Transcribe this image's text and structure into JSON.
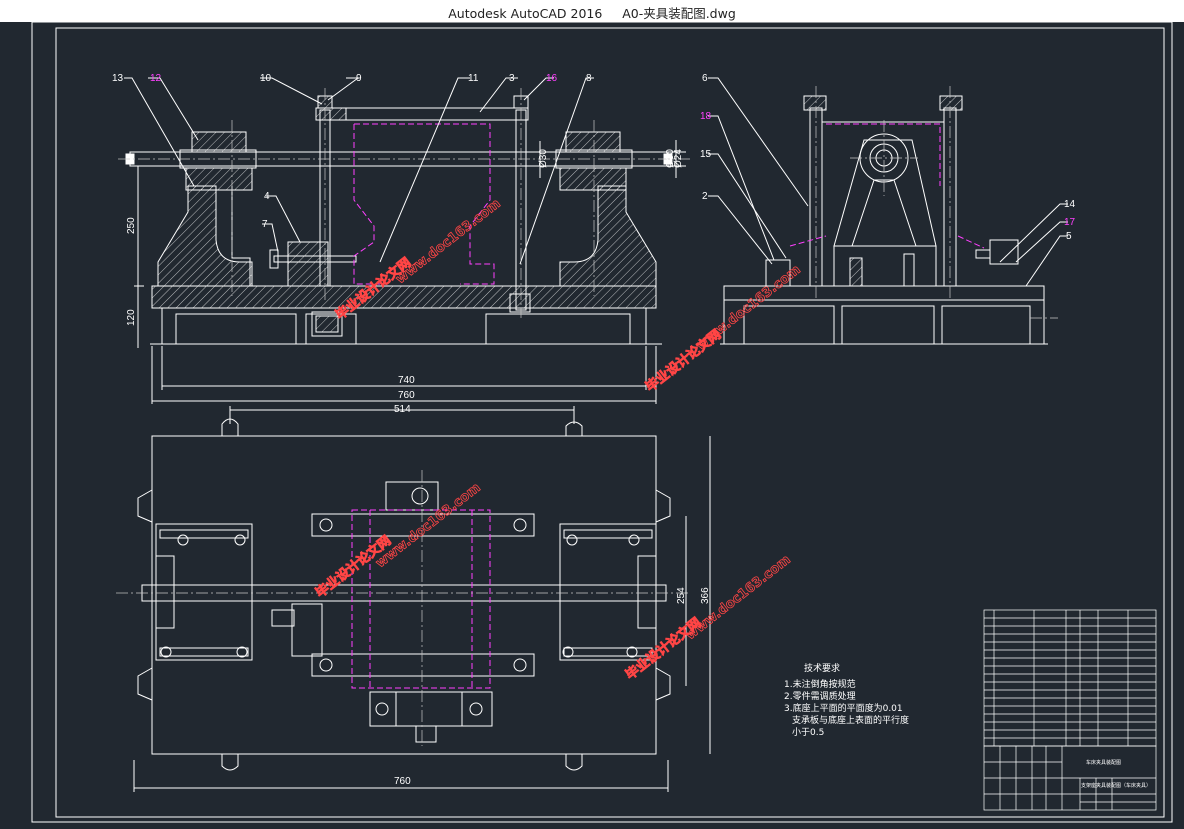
{
  "window": {
    "app_name": "Autodesk AutoCAD 2016",
    "file_name": "A0-夹具装配图.dwg"
  },
  "colors": {
    "background": "#212830",
    "line": "#ffffff",
    "hidden_line": "#ff40ff",
    "watermark": "#ff4545",
    "center_line": "#c8c8c8"
  },
  "front_view": {
    "part_labels": [
      "13",
      "12",
      "10",
      "9",
      "11",
      "3",
      "16",
      "8",
      "4",
      "7"
    ],
    "highlight_labels": [
      "12",
      "16"
    ],
    "dimensions": {
      "shaft_dia_1": "Ø30",
      "shaft_dia_2": "Ø30",
      "shaft_dia_3": "Ø24",
      "height_1": "250",
      "height_2": "120",
      "width_inner": "740",
      "width_outer": "760"
    }
  },
  "side_view": {
    "part_labels": [
      "6",
      "18",
      "15",
      "2",
      "14",
      "17",
      "5"
    ],
    "highlight_labels": [
      "18",
      "17"
    ]
  },
  "top_view": {
    "dimensions": {
      "top_width": "514",
      "bottom_width": "760",
      "height_inner": "254",
      "height_outer": "366"
    }
  },
  "technical_requirements": {
    "heading": "技术要求",
    "items": [
      "1.未注倒角按规范",
      "2.零件需调质处理",
      "3.底座上平面的平面度为0.01",
      "支承板与底座上表面的平行度",
      "小于0.5"
    ]
  },
  "title_block": {
    "drawing_title": "车床夹具装配图",
    "part_name": "支架座夹具装配图（车床夹具）"
  },
  "watermarks": [
    "毕业设计论文网",
    "www.doc163.com"
  ]
}
